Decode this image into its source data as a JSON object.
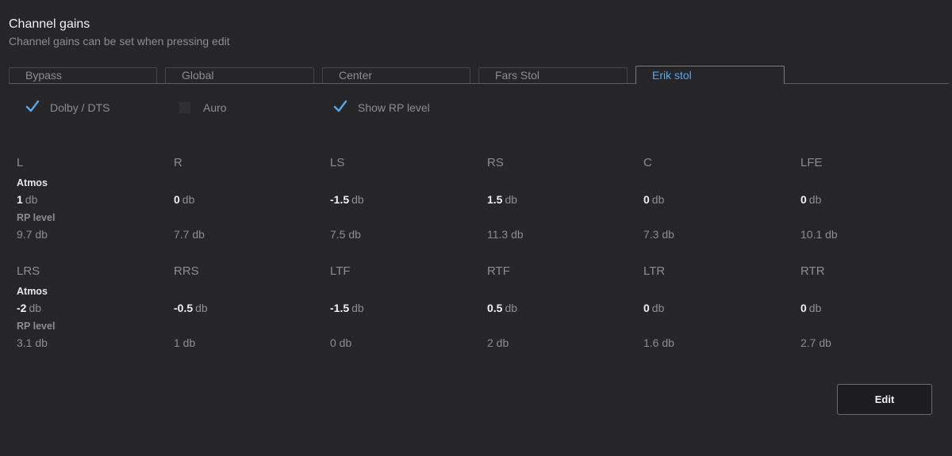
{
  "header": {
    "title": "Channel gains",
    "subtitle": "Channel gains can be set when pressing edit"
  },
  "tabs": [
    {
      "label": "Bypass",
      "active": false
    },
    {
      "label": "Global",
      "active": false
    },
    {
      "label": "Center",
      "active": false
    },
    {
      "label": "Fars Stol",
      "active": false
    },
    {
      "label": "Erik stol",
      "active": true
    }
  ],
  "options": [
    {
      "label": "Dolby / DTS",
      "checked": true
    },
    {
      "label": "Auro",
      "checked": false
    },
    {
      "label": "Show RP level",
      "checked": true
    }
  ],
  "labels": {
    "atmos": "Atmos",
    "rp_level": "RP level",
    "unit": "db"
  },
  "channels": [
    {
      "name": "L",
      "gain": "1",
      "rp": "9.7 db"
    },
    {
      "name": "R",
      "gain": "0",
      "rp": "7.7 db"
    },
    {
      "name": "LS",
      "gain": "-1.5",
      "rp": "7.5 db"
    },
    {
      "name": "RS",
      "gain": "1.5",
      "rp": "11.3 db"
    },
    {
      "name": "C",
      "gain": "0",
      "rp": "7.3 db"
    },
    {
      "name": "LFE",
      "gain": "0",
      "rp": "10.1 db"
    },
    {
      "name": "LRS",
      "gain": "-2",
      "rp": "3.1 db"
    },
    {
      "name": "RRS",
      "gain": "-0.5",
      "rp": "1 db"
    },
    {
      "name": "LTF",
      "gain": "-1.5",
      "rp": "0 db"
    },
    {
      "name": "RTF",
      "gain": "0.5",
      "rp": "2 db"
    },
    {
      "name": "LTR",
      "gain": "0",
      "rp": "1.6 db"
    },
    {
      "name": "RTR",
      "gain": "0",
      "rp": "2.7 db"
    }
  ],
  "actions": {
    "edit_label": "Edit"
  },
  "colors": {
    "background": "#262628",
    "accent": "#56a6e8",
    "text_primary": "#f2f2f2",
    "text_secondary": "#8d8d8f"
  }
}
